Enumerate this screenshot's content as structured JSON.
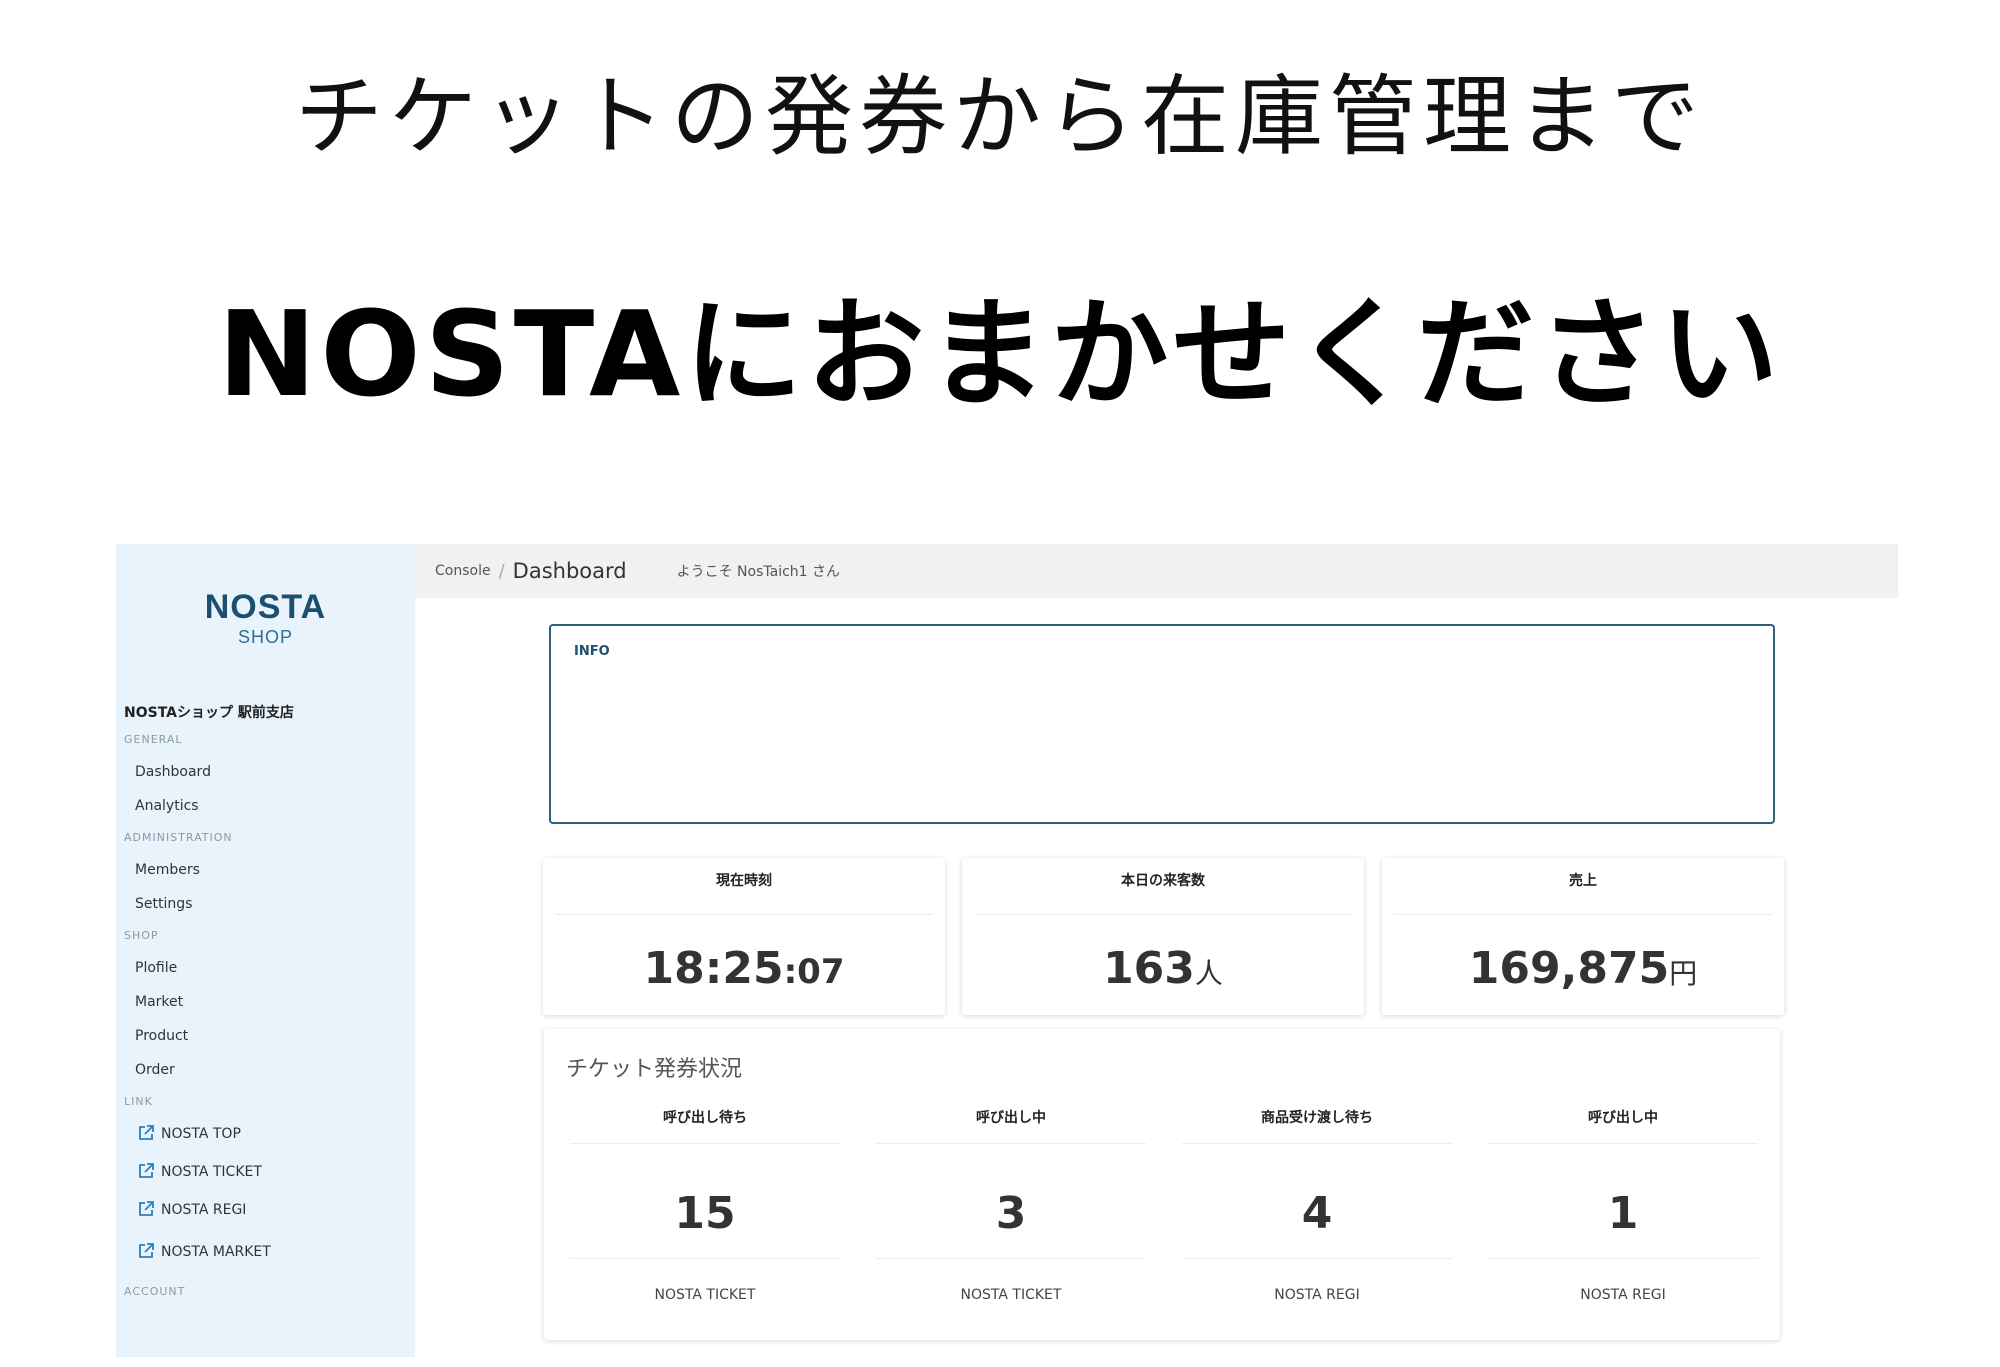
{
  "hero": {
    "subtitle": "チケットの発券から在庫管理まで",
    "title": "NOSTAにおまかせください"
  },
  "logo": {
    "main": "NOSTA",
    "sub": "SHOP"
  },
  "sidebar": {
    "shop_name": "NOSTAショップ 駅前支店",
    "sections": [
      {
        "label": "GENERAL",
        "items": [
          "Dashboard",
          "Analytics"
        ]
      },
      {
        "label": "ADMINISTRATION",
        "items": [
          "Members",
          "Settings"
        ]
      },
      {
        "label": "SHOP",
        "items": [
          "Plofile",
          "Market",
          "Product",
          "Order"
        ]
      },
      {
        "label": "LINK",
        "items": [
          "NOSTA TOP",
          "NOSTA TICKET",
          "NOSTA REGI",
          "NOSTA MARKET"
        ]
      },
      {
        "label": "ACCOUNT",
        "items": []
      }
    ]
  },
  "topbar": {
    "crumb_console": "Console",
    "crumb_sep": "/",
    "crumb_current": "Dashboard",
    "welcome": "ようこそ NosTaich1 さん"
  },
  "info": {
    "label": "INFO"
  },
  "cards": {
    "time": {
      "title": "現在時刻",
      "hm": "18:25",
      "sec": ":07"
    },
    "visitors": {
      "title": "本日の来客数",
      "value": "163",
      "unit": "人"
    },
    "sales": {
      "title": "売上",
      "value": "169,875",
      "unit": "円"
    }
  },
  "tickets": {
    "title": "チケット発券状況",
    "columns": [
      {
        "title": "呼び出し待ち",
        "value": "15",
        "source": "NOSTA TICKET"
      },
      {
        "title": "呼び出し中",
        "value": "3",
        "source": "NOSTA TICKET"
      },
      {
        "title": "商品受け渡し待ち",
        "value": "4",
        "source": "NOSTA REGI"
      },
      {
        "title": "呼び出し中",
        "value": "1",
        "source": "NOSTA REGI"
      }
    ]
  },
  "colors": {
    "sidebar_bg": "#e8f3fc",
    "brand": "#1b4f6e",
    "accent": "#2d5f7f",
    "topbar_bg": "#f1f1f1"
  },
  "icons": {
    "link_icon": "external-link-icon"
  }
}
